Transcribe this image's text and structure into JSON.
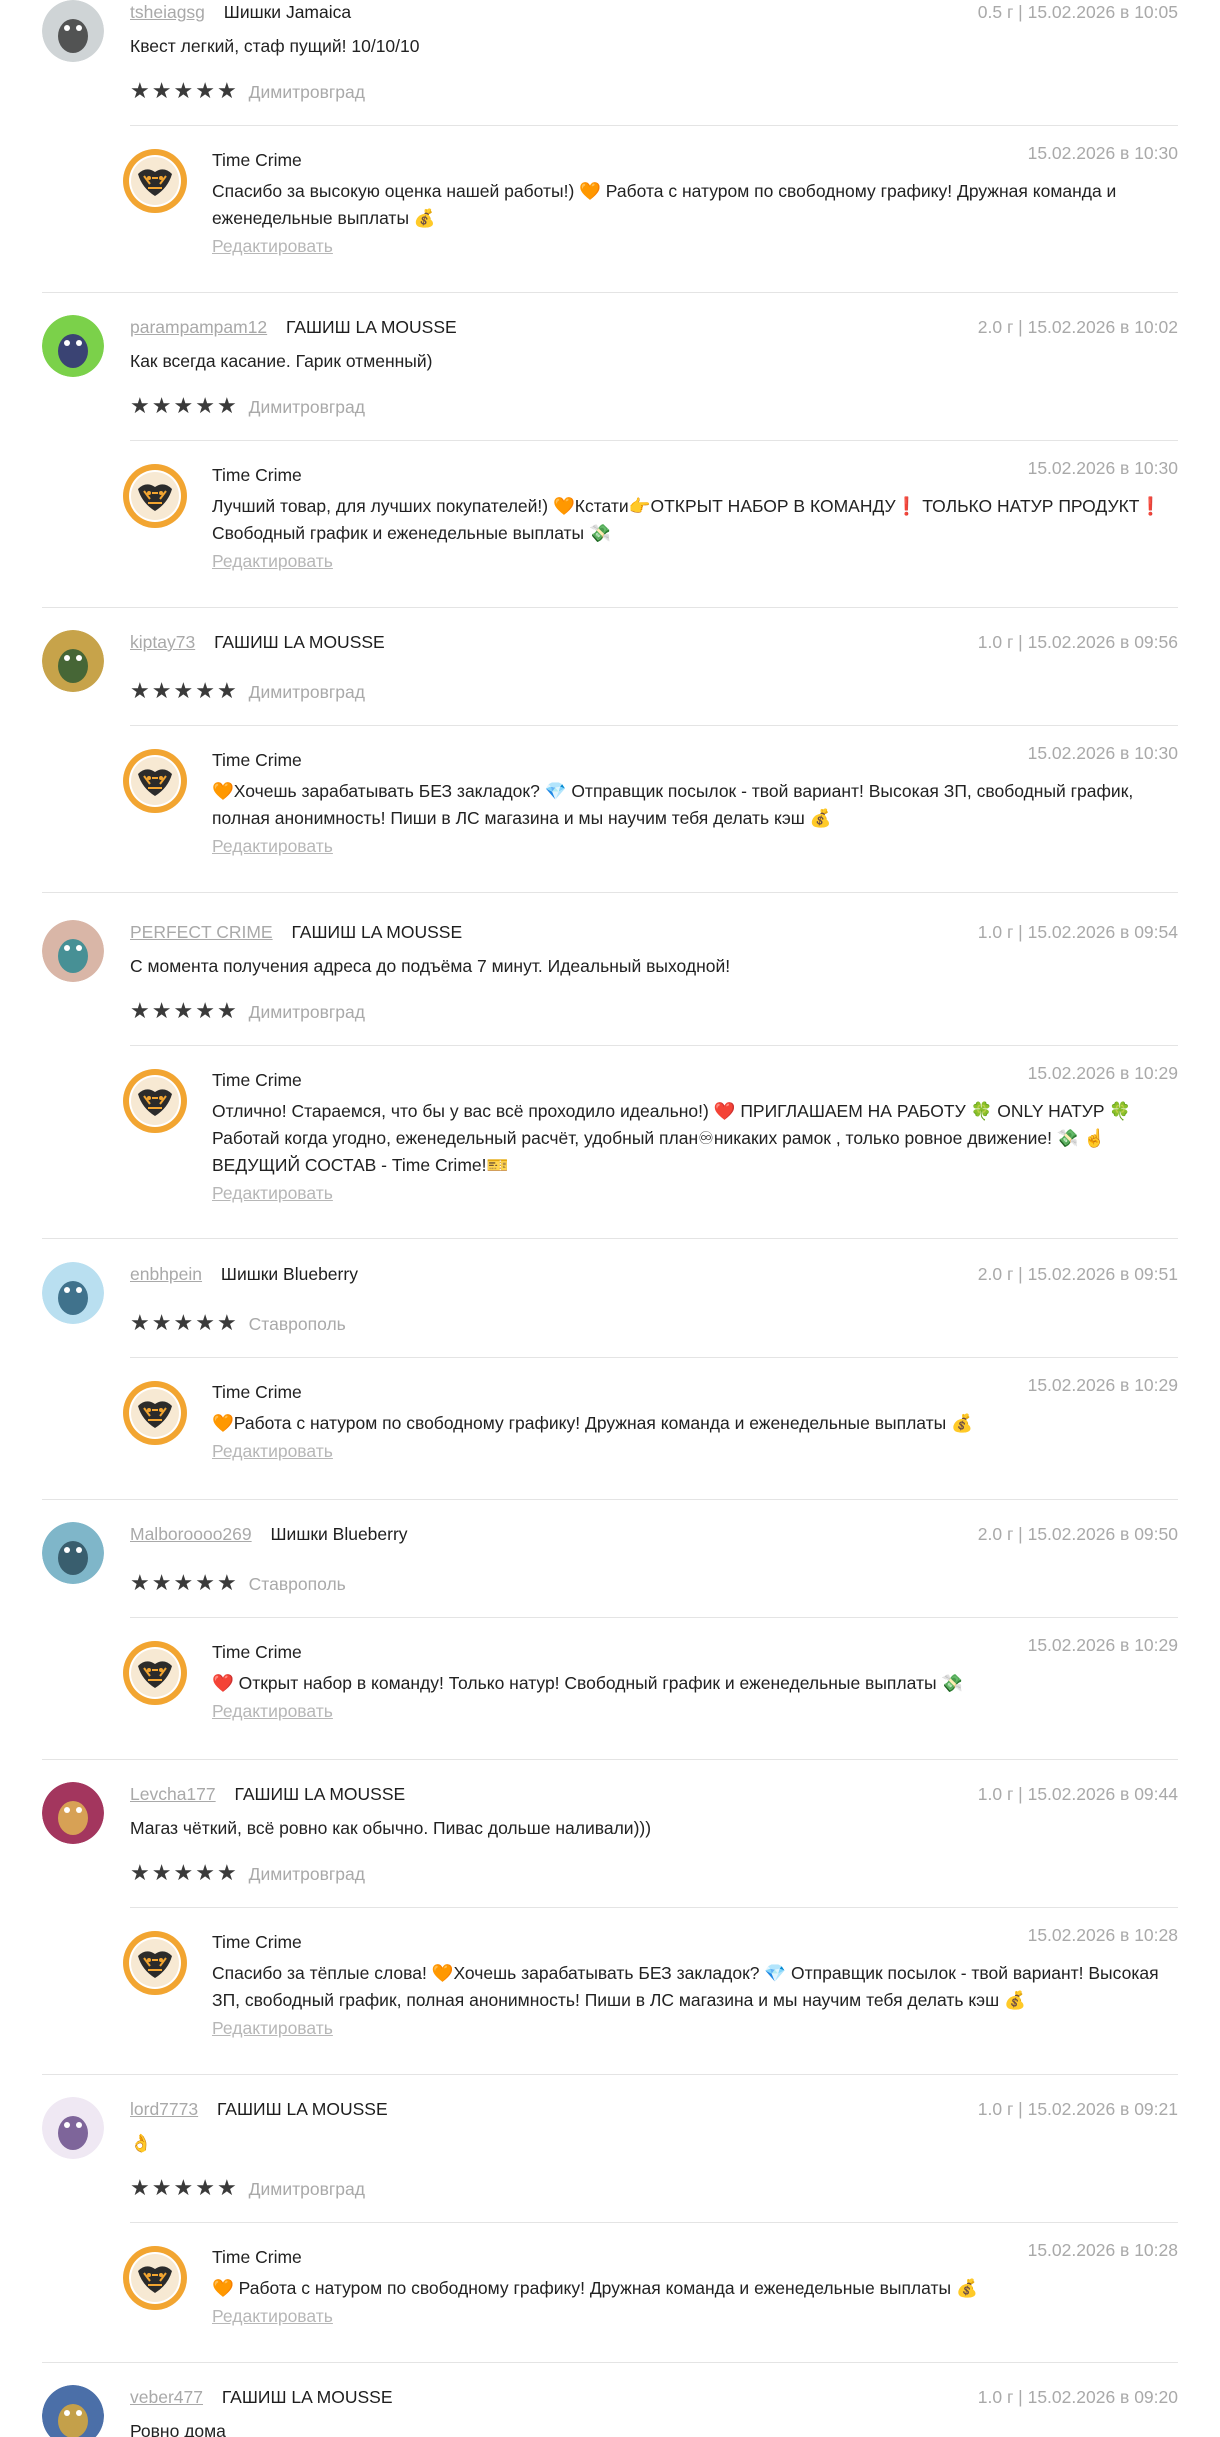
{
  "reviews": [
    {
      "username": "tsheiagsg",
      "product": "Шишки Jamaica",
      "meta": "0.5 г | 15.02.2026 в 10:05",
      "text": "Квест легкий, стаф пущий! 10/10/10",
      "rating": 5,
      "city": "Димитровград",
      "avatar_icon": "cat-avatar-icon",
      "reply": {
        "author": "Time Crime",
        "date": "15.02.2026 в 10:30",
        "text": "Спасибо за высокую оценка нашей работы!) 🧡 Работа с натуром по свободному графику! Дружная команда и еженедельные выплаты 💰",
        "edit_label": "Редактировать"
      }
    },
    {
      "username": "parampampam12",
      "product": "ГАШИШ LA MOUSSE",
      "meta": "2.0 г | 15.02.2026 в 10:02",
      "text": "Как всегда касание. Гарик отменный)",
      "rating": 5,
      "city": "Димитровград",
      "avatar_icon": "tools-avatar-icon",
      "reply": {
        "author": "Time Crime",
        "date": "15.02.2026 в 10:30",
        "text": "Лучший товар, для лучших покупателей!) 🧡Кстати👉ОТКРЫТ НАБОР В КОМАНДУ❗ ТОЛЬКО НАТУР ПРОДУКТ❗ Свободный график и еженедельные выплаты 💸",
        "edit_label": "Редактировать"
      }
    },
    {
      "username": "kiptay73",
      "product": "ГАШИШ LA MOUSSE",
      "meta": "1.0 г | 15.02.2026 в 09:56",
      "text": "",
      "rating": 5,
      "city": "Димитровград",
      "avatar_icon": "creature-avatar-icon",
      "reply": {
        "author": "Time Crime",
        "date": "15.02.2026 в 10:30",
        "text": "🧡Хочешь зарабатывать БЕЗ закладок? 💎 Отправщик посылок - твой вариант! Высокая ЗП, свободный график, полная анонимность! Пиши в ЛС магазина и мы научим тебя делать кэш 💰",
        "edit_label": "Редактировать"
      }
    },
    {
      "username": "PERFECT CRIME",
      "product": "ГАШИШ LA MOUSSE",
      "meta": "1.0 г | 15.02.2026 в 09:54",
      "text": "С момента получения адреса до подъёма 7 минут. Идеальный выходной!",
      "rating": 5,
      "city": "Димитровград",
      "avatar_icon": "glasses-avatar-icon",
      "reply": {
        "author": "Time Crime",
        "date": "15.02.2026 в 10:29",
        "text": "Отлично! Стараемся, что бы у вас всё проходило идеально!) ❤️ ПРИГЛАШАЕМ НА РАБОТУ 🍀 ONLY НАТУР 🍀 Работай когда угодно, еженедельный расчёт, удобный план♾никаких рамок , только ровное движение! 💸 ☝️ ВЕДУЩИЙ СОСТАВ - Time Crime!🎫",
        "edit_label": "Редактировать"
      }
    },
    {
      "username": "enbhpein",
      "product": "Шишки Blueberry",
      "meta": "2.0 г | 15.02.2026 в 09:51",
      "text": "",
      "rating": 5,
      "city": "Ставрополь",
      "avatar_icon": "tiger-avatar-icon",
      "reply": {
        "author": "Time Crime",
        "date": "15.02.2026 в 10:29",
        "text": "🧡Работа с натуром по свободному графику! Дружная команда и еженедельные выплаты 💰",
        "edit_label": "Редактировать"
      }
    },
    {
      "username": "Malboroooo269",
      "product": "Шишки Blueberry",
      "meta": "2.0 г | 15.02.2026 в 09:50",
      "text": "",
      "rating": 5,
      "city": "Ставрополь",
      "avatar_icon": "badge-avatar-icon",
      "reply": {
        "author": "Time Crime",
        "date": "15.02.2026 в 10:29",
        "text": "❤️ Открыт набор в команду! Только натур! Свободный график и еженедельные выплаты 💸",
        "edit_label": "Редактировать"
      }
    },
    {
      "username": "Levcha177",
      "product": "ГАШИШ LA MOUSSE",
      "meta": "1.0 г | 15.02.2026 в 09:44",
      "text": "Магаз чёткий, всё ровно как обычно. Пивас дольше наливали)))",
      "rating": 5,
      "city": "Димитровград",
      "avatar_icon": "character-avatar-icon",
      "reply": {
        "author": "Time Crime",
        "date": "15.02.2026 в 10:28",
        "text": "Спасибо за тёплые слова! 🧡Хочешь зарабатывать БЕЗ закладок? 💎 Отправщик посылок - твой вариант! Высокая ЗП, свободный график, полная анонимность! Пиши в ЛС магазина и мы научим тебя делать кэш 💰",
        "edit_label": "Редактировать"
      }
    },
    {
      "username": "lord7773",
      "product": "ГАШИШ LA MOUSSE",
      "meta": "1.0 г | 15.02.2026 в 09:21",
      "text": "👌",
      "rating": 5,
      "city": "Димитровград",
      "avatar_icon": "ghost-avatar-icon",
      "reply": {
        "author": "Time Crime",
        "date": "15.02.2026 в 10:28",
        "text": "🧡 Работа с натуром по свободному графику! Дружная команда и еженедельные выплаты 💰",
        "edit_label": "Редактировать"
      }
    },
    {
      "username": "veber477",
      "product": "ГАШИШ LA MOUSSE",
      "meta": "1.0 г | 15.02.2026 в 09:20",
      "text": "Ровно дома",
      "avatar_icon": "coin-avatar-icon"
    }
  ],
  "colors": {
    "star": "#3a3a3a",
    "muted": "#a9a9a9",
    "divider": "#e4e4e4",
    "brand_orange": "#f2a531"
  }
}
